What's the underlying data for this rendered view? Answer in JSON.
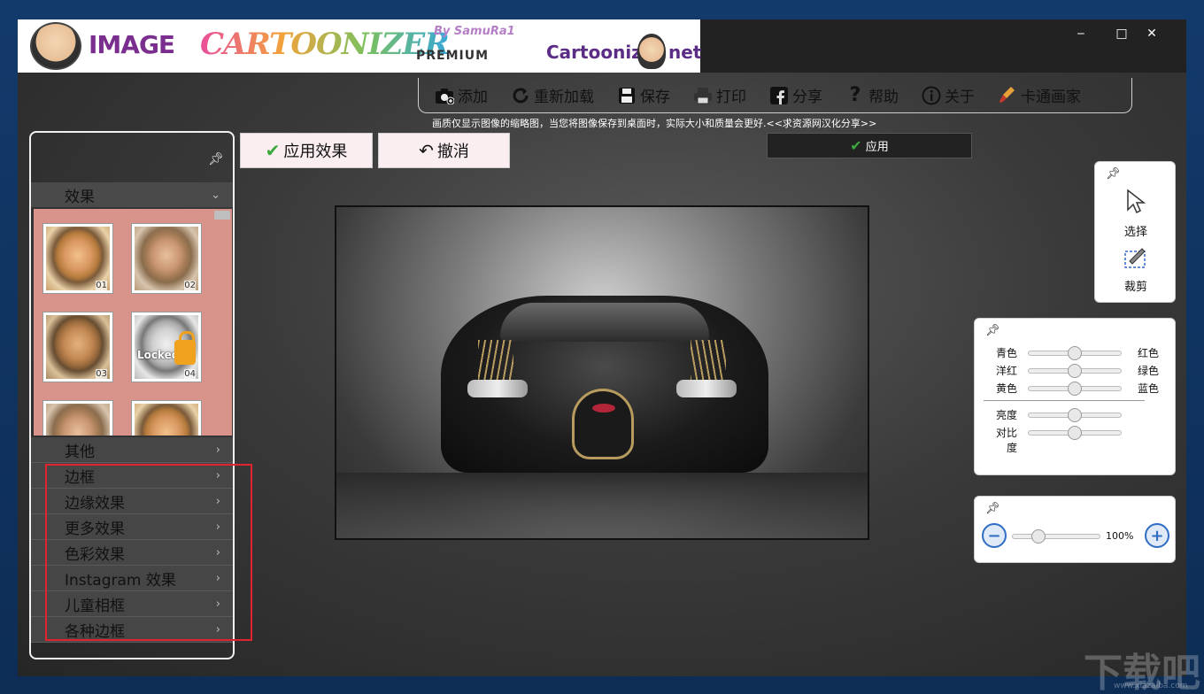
{
  "titlebar": {
    "logo_word1": "IMAGE",
    "logo_word2": "CARTOONIZER",
    "logo_by": "By SamuRa1",
    "logo_edition": "PREMIUM",
    "logo_site_prefix": "Cartoonize",
    "logo_site_suffix": "net",
    "minimize": "‒",
    "maximize": "□",
    "close": "✕"
  },
  "toolbar": {
    "items": [
      {
        "label": "添加",
        "icon": "camera-add-icon"
      },
      {
        "label": "重新加载",
        "icon": "reload-icon"
      },
      {
        "label": "保存",
        "icon": "save-icon"
      },
      {
        "label": "打印",
        "icon": "print-icon"
      },
      {
        "label": "分享",
        "icon": "facebook-icon"
      },
      {
        "label": "帮助",
        "icon": "help-icon"
      },
      {
        "label": "关于",
        "icon": "info-icon"
      },
      {
        "label": "卡通画家",
        "icon": "paint-brush-icon"
      }
    ],
    "hint": "画质仅显示图像的缩略图，当您将图像保存到桌面时，实际大小和质量会更好.<<求资源网汉化分享>>"
  },
  "left_panel": {
    "effects_header": "效果",
    "thumbnails": [
      {
        "num": "01",
        "locked": false
      },
      {
        "num": "02",
        "locked": false
      },
      {
        "num": "03",
        "locked": false
      },
      {
        "num": "04",
        "locked": true,
        "locked_label": "Locked"
      },
      {
        "num": "",
        "locked": true
      },
      {
        "num": "",
        "locked": true
      }
    ],
    "categories": [
      "其他",
      "边框",
      "边缘效果",
      "更多效果",
      "色彩效果",
      "Instagram 效果",
      "儿童相框",
      "各种边框"
    ]
  },
  "actions": {
    "apply_effect": "应用效果",
    "undo": "撤消",
    "apply": "应用"
  },
  "tools": {
    "select": "选择",
    "crop": "裁剪"
  },
  "color_adjust": {
    "rows": [
      {
        "left": "青色",
        "right": "红色",
        "level": 0.5
      },
      {
        "left": "洋红",
        "right": "绿色",
        "level": 0.5
      },
      {
        "left": "黄色",
        "right": "蓝色",
        "level": 0.5
      },
      {
        "left": "亮度",
        "right": "",
        "level": 0.5
      },
      {
        "left": "对比度",
        "right": "",
        "level": 0.5
      }
    ]
  },
  "zoom": {
    "value": "100%",
    "level": 0.25
  },
  "watermark": {
    "text": "下载吧",
    "url": "www.xiazaiba.com"
  },
  "colors": {
    "accent_green": "#3ca83c",
    "highlight_red": "#e0232e",
    "thumb_bg": "#d8938a"
  }
}
